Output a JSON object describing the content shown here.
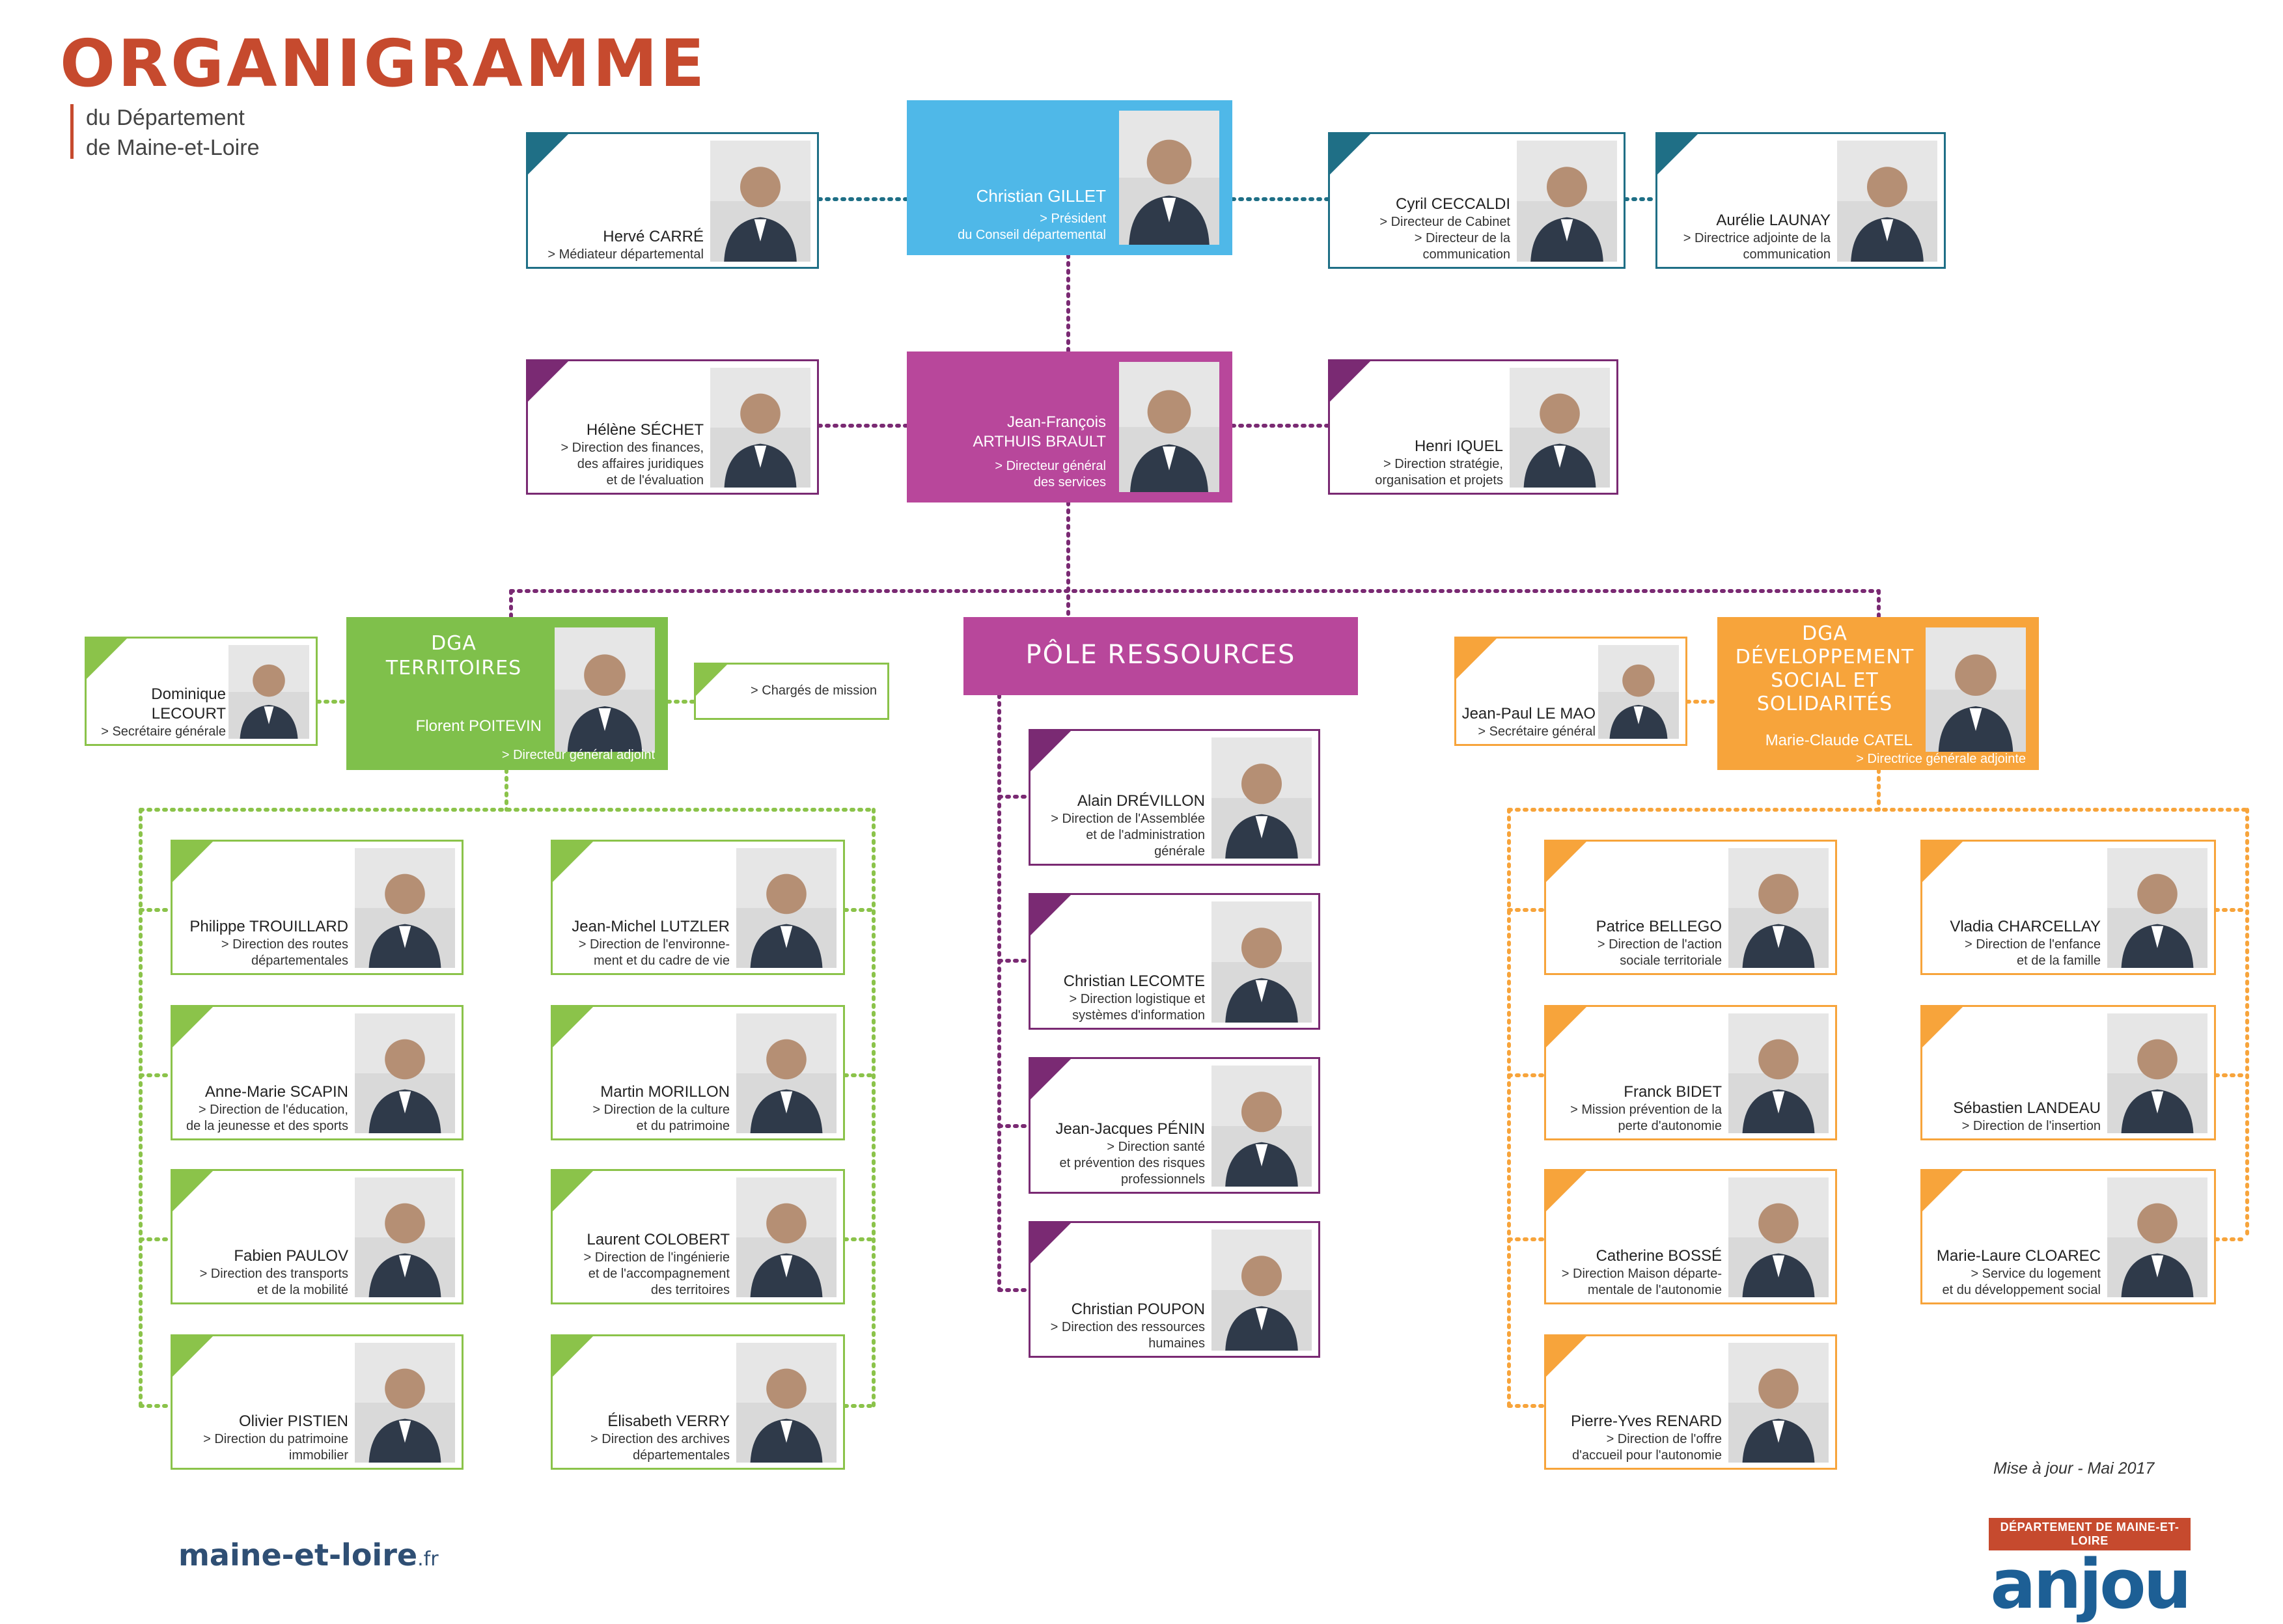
{
  "header": {
    "title": "ORGANIGRAMME",
    "subtitle_line1": "du Département",
    "subtitle_line2": "de Maine-et-Loire"
  },
  "colors": {
    "teal": "#1f6f86",
    "blue": "#4fb8e8",
    "purple": "#b8479b",
    "purple_dark": "#7a2a73",
    "green": "#8bc34a",
    "green_box": "#7fc04b",
    "orange": "#f7a43b",
    "brand": "#c64a2e"
  },
  "president": {
    "name": "Christian GILLET",
    "role": "> Président\ndu Conseil départemental",
    "icon": "person-photo"
  },
  "top_cards": [
    {
      "name": "Hervé CARRÉ",
      "role": "> Médiateur départemental",
      "icon": "person-photo"
    },
    {
      "name": "Cyril CECCALDI",
      "role": "> Directeur de Cabinet\n> Directeur de la\ncommunication",
      "icon": "person-photo"
    },
    {
      "name": "Aurélie LAUNAY",
      "role": "> Directrice adjointe de la\ncommunication",
      "icon": "person-photo"
    }
  ],
  "dgs": {
    "name": "Jean-François\nARTHUIS BRAULT",
    "role": "> Directeur général\ndes services",
    "icon": "person-photo"
  },
  "dgs_cards": [
    {
      "name": "Hélène SÉCHET",
      "role": "> Direction des finances,\ndes affaires juridiques\net de l'évaluation",
      "icon": "person-photo"
    },
    {
      "name": "Henri IQUEL",
      "role": "> Direction stratégie,\norganisation et projets",
      "icon": "person-photo"
    }
  ],
  "dga_territoires": {
    "title": "DGA\nTERRITOIRES",
    "name": "Florent POITEVIN",
    "role": "> Directeur général adjoint",
    "secretary": {
      "name": "Dominique LECOURT",
      "role": "> Secrétaire générale"
    },
    "charges": "> Chargés de mission",
    "left": [
      {
        "name": "Philippe TROUILLARD",
        "role": "> Direction des routes\ndépartementales"
      },
      {
        "name": "Anne-Marie SCAPIN",
        "role": "> Direction de l'éducation,\nde la jeunesse et des sports"
      },
      {
        "name": "Fabien PAULOV",
        "role": "> Direction des transports\net de la mobilité"
      },
      {
        "name": "Olivier PISTIEN",
        "role": "> Direction du patrimoine\nimmobilier"
      }
    ],
    "right": [
      {
        "name": "Jean-Michel LUTZLER",
        "role": "> Direction de l'environne-\nment et du cadre de vie"
      },
      {
        "name": "Martin MORILLON",
        "role": "> Direction de la culture\net du patrimoine"
      },
      {
        "name": "Laurent COLOBERT",
        "role": "> Direction de l'ingénierie\net de l'accompagnement\ndes territoires"
      },
      {
        "name": "Élisabeth VERRY",
        "role": "> Direction des archives\ndépartementales"
      }
    ]
  },
  "pole_ressources": {
    "title": "PÔLE RESSOURCES",
    "items": [
      {
        "name": "Alain DRÉVILLON",
        "role": "> Direction de l'Assemblée\net de l'administration\ngénérale"
      },
      {
        "name": "Christian LECOMTE",
        "role": "> Direction logistique et\nsystèmes d'information"
      },
      {
        "name": "Jean-Jacques PÉNIN",
        "role": "> Direction santé\net prévention des risques\nprofessionnels"
      },
      {
        "name": "Christian POUPON",
        "role": "> Direction des ressources\nhumaines"
      }
    ]
  },
  "dga_social": {
    "title": "DGA\nDÉVELOPPEMENT\nSOCIAL ET\nSOLIDARITÉS",
    "name": "Marie-Claude CATEL",
    "role": "> Directrice générale adjointe",
    "secretary": {
      "name": "Jean-Paul LE MAO",
      "role": "> Secrétaire général"
    },
    "left": [
      {
        "name": "Patrice BELLEGO",
        "role": "> Direction de l'action\nsociale territoriale"
      },
      {
        "name": "Franck BIDET",
        "role": "> Mission prévention de la\nperte d'autonomie"
      },
      {
        "name": "Catherine BOSSÉ",
        "role": "> Direction Maison départe-\nmentale de l'autonomie"
      },
      {
        "name": "Pierre-Yves RENARD",
        "role": "> Direction de l'offre\nd'accueil pour l'autonomie"
      }
    ],
    "right": [
      {
        "name": "Vladia CHARCELLAY",
        "role": "> Direction de l'enfance\net de la famille"
      },
      {
        "name": "Sébastien LANDEAU",
        "role": "> Direction de l'insertion"
      },
      {
        "name": "Marie-Laure CLOAREC",
        "role": "> Service du logement\net du développement social"
      }
    ]
  },
  "footer": {
    "update": "Mise à jour - Mai 2017",
    "site_main": "maine-et-loire",
    "site_tld": ".fr",
    "logo_band": "DÉPARTEMENT DE MAINE-ET-LOIRE",
    "logo_word": "anjou"
  }
}
